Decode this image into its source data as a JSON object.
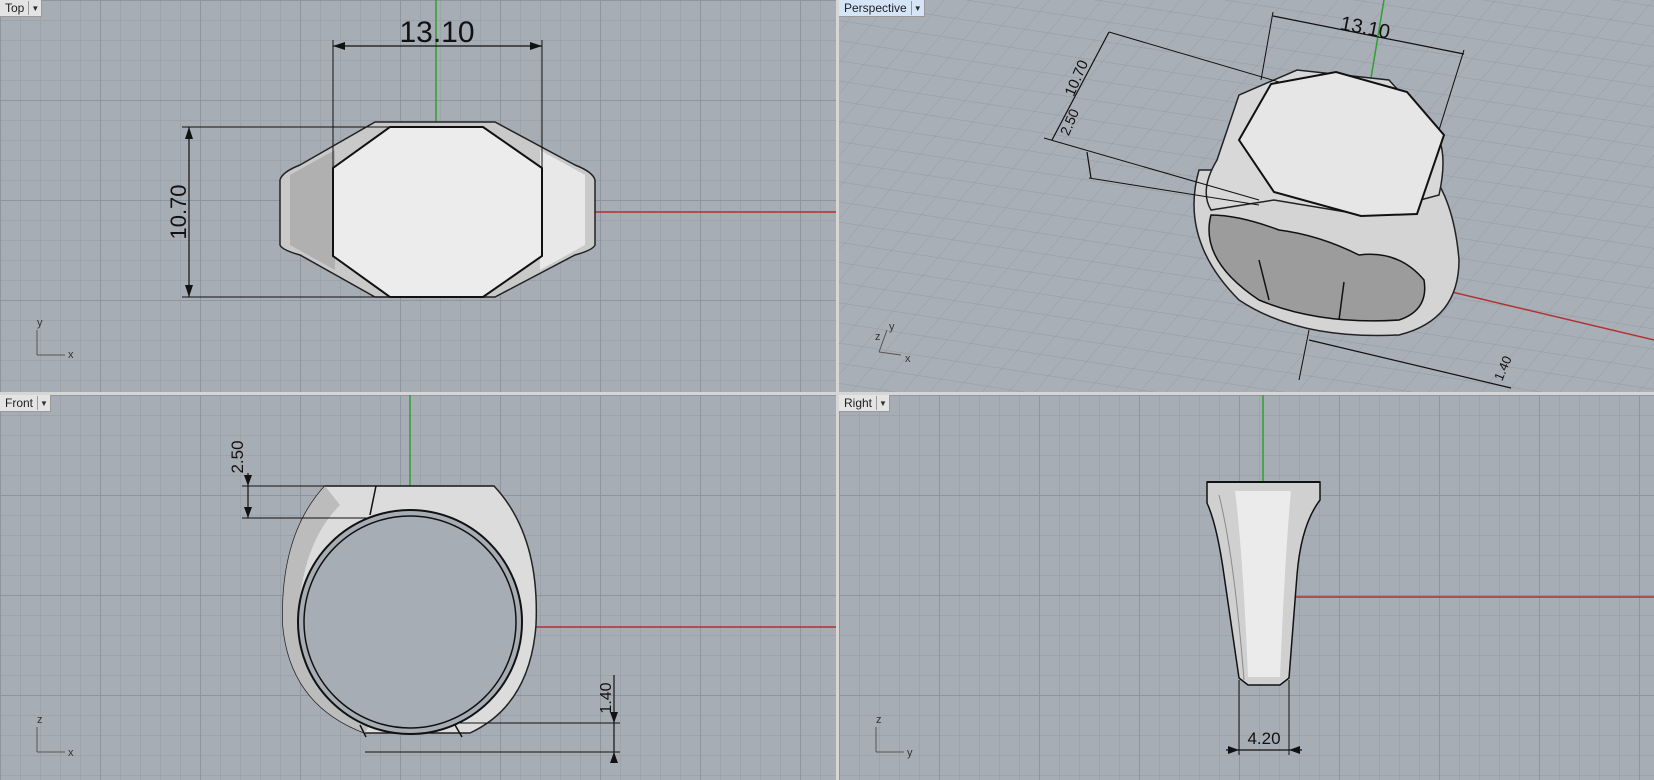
{
  "viewports": {
    "top": {
      "label": "Top"
    },
    "persp": {
      "label": "Perspective"
    },
    "front": {
      "label": "Front"
    },
    "right": {
      "label": "Right"
    }
  },
  "dimensions": {
    "top_width": "13.10",
    "top_height": "10.70",
    "persp_width": "13.10",
    "persp_height": "10.70",
    "persp_thickness": "2.50",
    "persp_shank": "1.40",
    "front_thickness": "2.50",
    "front_shank": "1.40",
    "right_width": "4.20"
  },
  "axis_labels": {
    "top": {
      "a": "y",
      "b": "x"
    },
    "persp": {
      "a": "y",
      "b": "x",
      "c": "z"
    },
    "front": {
      "a": "z",
      "b": "x"
    },
    "right": {
      "a": "z",
      "b": "y"
    }
  },
  "colors": {
    "x_axis": "#b43030",
    "y_axis": "#2fa02f",
    "viewport_bg": "#a7adb5",
    "active_tab": "#d5e4f7"
  }
}
